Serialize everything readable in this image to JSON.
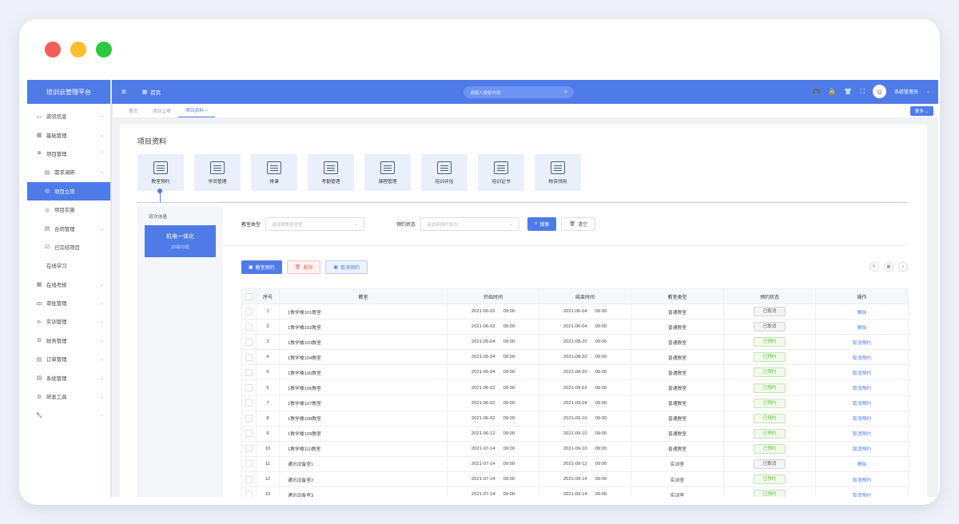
{
  "window": {
    "dots": [
      "#f25f58",
      "#fbbe2e",
      "#2bc840"
    ]
  },
  "brand": "培训云管理平台",
  "sidebar": {
    "items": [
      {
        "icon": "▭",
        "label": "资讯信息",
        "chev": "⌄",
        "cls": ""
      },
      {
        "icon": "▦",
        "label": "基础管理",
        "chev": "⌄",
        "cls": ""
      },
      {
        "icon": "⧇",
        "label": "项目管理",
        "chev": "⌃",
        "cls": ""
      },
      {
        "icon": "▤",
        "label": "需求调研",
        "chev": "⌄",
        "cls": "sub"
      },
      {
        "icon": "◎",
        "label": "项目立项",
        "chev": "",
        "cls": "sub active"
      },
      {
        "icon": "◎",
        "label": "项目实施",
        "chev": "",
        "cls": "sub"
      },
      {
        "icon": "▤",
        "label": "合同管理",
        "chev": "⌄",
        "cls": "sub"
      },
      {
        "icon": "☑",
        "label": "已完结项目",
        "chev": "",
        "cls": "sub"
      },
      {
        "icon": "",
        "label": "在线学习",
        "chev": "",
        "cls": ""
      },
      {
        "icon": "▦",
        "label": "在线考核",
        "chev": "⌄",
        "cls": ""
      },
      {
        "icon": "ꝏ",
        "label": "审批管理",
        "chev": "⌄",
        "cls": ""
      },
      {
        "icon": "⊳",
        "label": "实训管理",
        "chev": "⌄",
        "cls": ""
      },
      {
        "icon": "⚙",
        "label": "财务管理",
        "chev": "⌄",
        "cls": ""
      },
      {
        "icon": "▤",
        "label": "订单管理",
        "chev": "⌄",
        "cls": ""
      },
      {
        "icon": "▤",
        "label": "系统管理",
        "chev": "⌄",
        "cls": ""
      },
      {
        "icon": "⚙",
        "label": "研发工具",
        "chev": "⌄",
        "cls": ""
      },
      {
        "icon": "🔧",
        "label": "",
        "chev": "⌄",
        "cls": ""
      }
    ]
  },
  "topbar": {
    "home_label": "首页",
    "search_placeholder": "请输入搜索内容",
    "user_name": "系统管理员"
  },
  "tabs": [
    {
      "label": "首页",
      "active": false
    },
    {
      "label": "项目立项",
      "active": false
    },
    {
      "label": "项目资料 ×",
      "active": true
    }
  ],
  "more_label": "更多 ⌄",
  "page_title": "项目资料",
  "modules": [
    "教室预约",
    "学员管理",
    "排课",
    "考勤管理",
    "课程管理",
    "培训评估",
    "培训证书",
    "物资领用"
  ],
  "batch": {
    "title": "班次信息",
    "name": "机电一体化",
    "code": "20级03班"
  },
  "filters": {
    "type_label": "教室类型",
    "type_placeholder": "请选择教室类型",
    "status_label": "预约状态",
    "status_placeholder": "请选择预约状态",
    "search_btn": "搜索",
    "clear_btn": "清空"
  },
  "actions": {
    "reserve": "教室预约",
    "delete": "删除",
    "cancel": "取消预约"
  },
  "table": {
    "headers": [
      "序号",
      "教室",
      "开始时间",
      "结束时间",
      "教室类型",
      "预约状态",
      "操作"
    ],
    "rows": [
      [
        "1",
        "1教学楼101教室",
        "2021-06-02",
        "09:00",
        "2021-06-04",
        "09:00",
        "普通教室",
        "已取消",
        "删除"
      ],
      [
        "2",
        "1教学楼102教室",
        "2021-06-02",
        "09:00",
        "2021-06-04",
        "09:00",
        "普通教室",
        "已取消",
        "删除"
      ],
      [
        "3",
        "1教学楼103教室",
        "2021-05-04",
        "09:00",
        "2021-08-20",
        "09:00",
        "普通教室",
        "已预约",
        "取消预约"
      ],
      [
        "4",
        "1教学楼104教室",
        "2021-05-04",
        "09:00",
        "2021-08-20",
        "09:00",
        "普通教室",
        "已预约",
        "取消预约"
      ],
      [
        "5",
        "1教学楼105教室",
        "2021-05-04",
        "09:00",
        "2021-08-20",
        "09:00",
        "普通教室",
        "已预约",
        "取消预约"
      ],
      [
        "6",
        "1教学楼106教室",
        "2021-06-02",
        "09:00",
        "2021-09-02",
        "09:00",
        "普通教室",
        "已预约",
        "取消预约"
      ],
      [
        "7",
        "1教学楼107教室",
        "2021-06-02",
        "09:00",
        "2021-09-04",
        "09:00",
        "普通教室",
        "已预约",
        "取消预约"
      ],
      [
        "8",
        "1教学楼108教室",
        "2021-06-02",
        "09:00",
        "2021-09-10",
        "09:00",
        "普通教室",
        "已预约",
        "取消预约"
      ],
      [
        "9",
        "1教学楼109教室",
        "2021-06-12",
        "09:00",
        "2021-09-10",
        "09:00",
        "普通教室",
        "已预约",
        "取消预约"
      ],
      [
        "10",
        "1教学楼110教室",
        "2021-07-14",
        "09:00",
        "2021-09-10",
        "09:00",
        "普通教室",
        "已预约",
        "取消预约"
      ],
      [
        "11",
        "通讯设备室1",
        "2021-07-14",
        "09:00",
        "2021-09-12",
        "09:00",
        "实训室",
        "已取消",
        "删除"
      ],
      [
        "12",
        "通讯设备室2",
        "2021-07-14",
        "09:00",
        "2021-09-14",
        "09:00",
        "实训室",
        "已预约",
        "取消预约"
      ],
      [
        "13",
        "通讯设备室3",
        "2021-07-14",
        "09:00",
        "2021-09-14",
        "09:00",
        "实训室",
        "已预约",
        "取消预约"
      ]
    ]
  }
}
